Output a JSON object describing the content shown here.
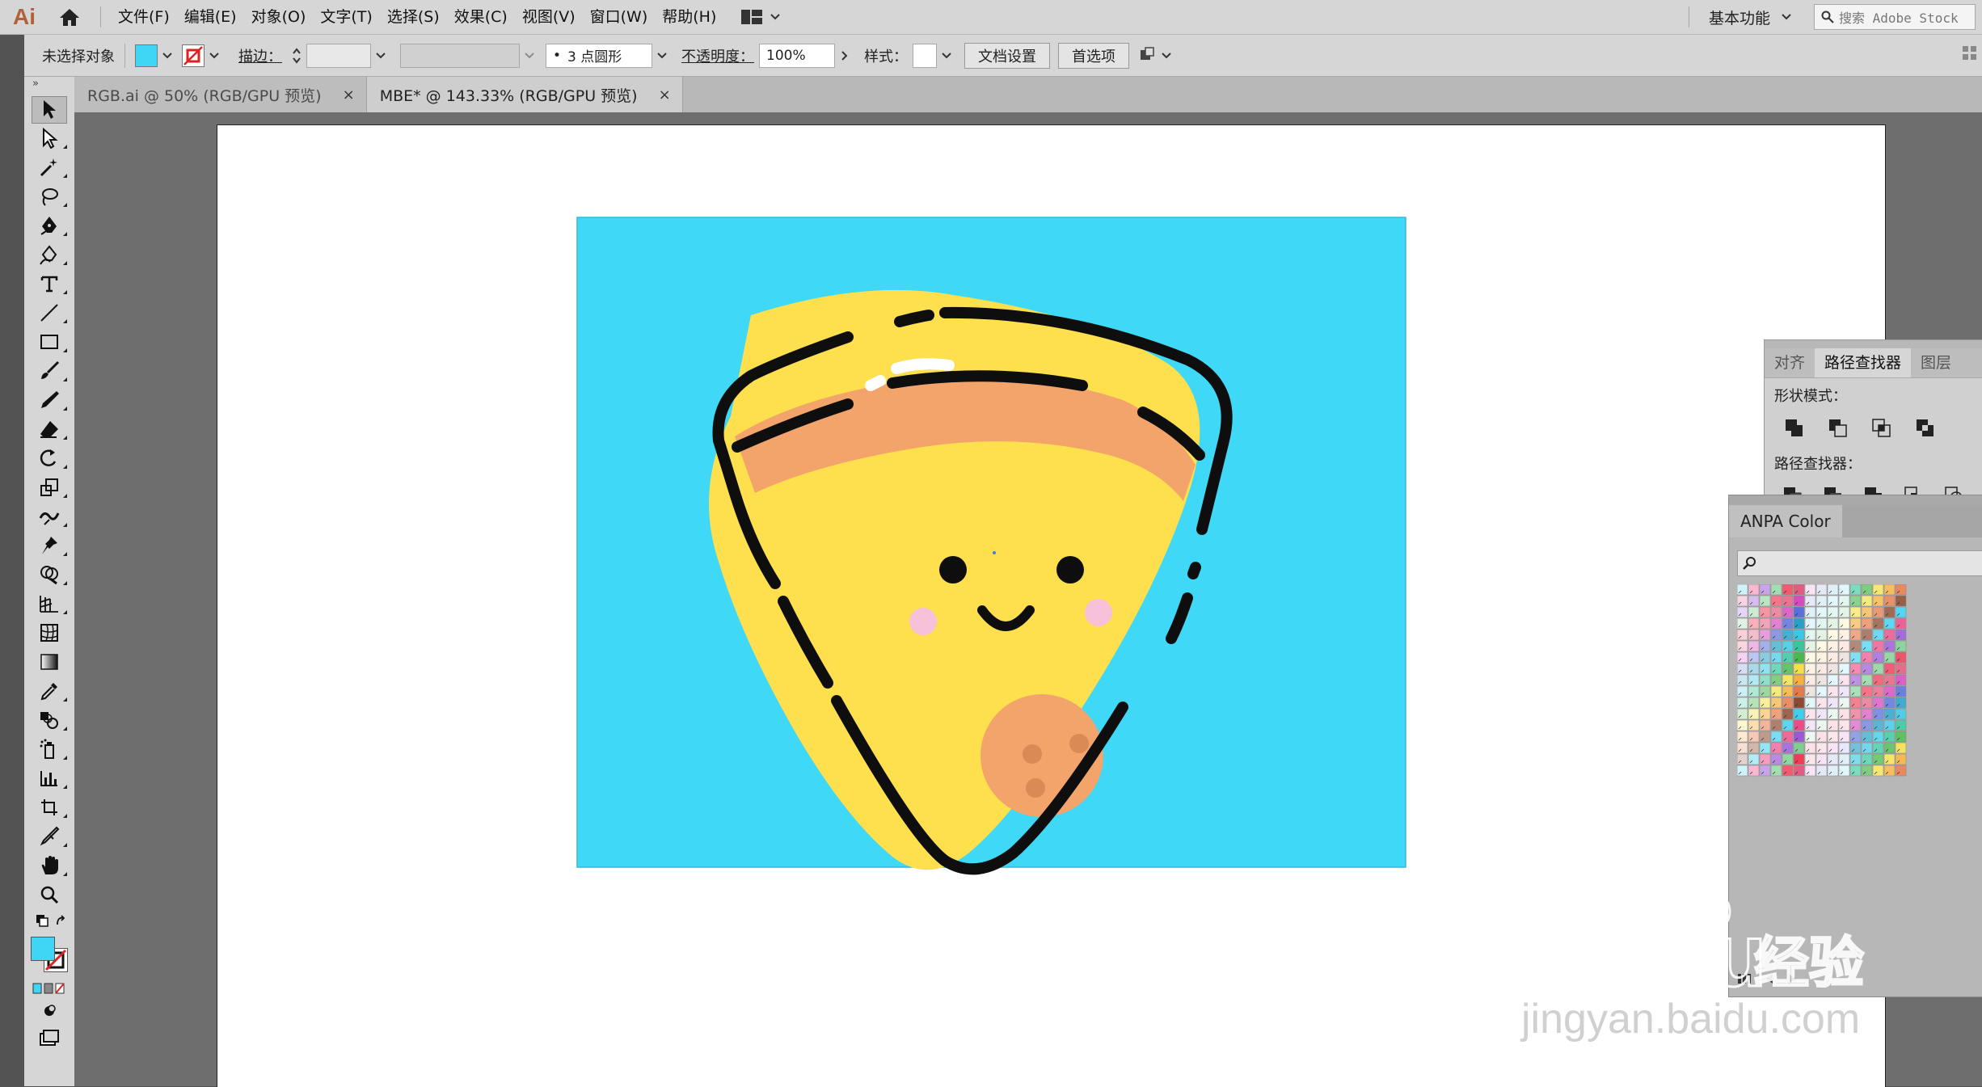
{
  "app": {
    "logo": "Ai",
    "menu": [
      "文件(F)",
      "编辑(E)",
      "对象(O)",
      "文字(T)",
      "选择(S)",
      "效果(C)",
      "视图(V)",
      "窗口(W)",
      "帮助(H)"
    ],
    "workspace_label": "基本功能",
    "stock_search_placeholder": "搜索 Adobe Stock"
  },
  "control_bar": {
    "selection_status": "未选择对象",
    "fill_color": "#3fd6f5",
    "stroke_label": "描边：",
    "brush_label": "3 点圆形",
    "brush_dot": "•",
    "opacity_label": "不透明度：",
    "opacity_value": "100%",
    "style_label": "样式：",
    "doc_setup_button": "文档设置",
    "preferences_button": "首选项"
  },
  "tabs": [
    {
      "label": "RGB.ai @ 50% (RGB/GPU 预览)",
      "close": "×",
      "active": false
    },
    {
      "label": "MBE* @ 143.33% (RGB/GPU 预览)",
      "close": "×",
      "active": true
    }
  ],
  "toolbar": {
    "grip": "»",
    "tools": [
      "selection-tool",
      "direct-selection-tool",
      "magic-wand-tool",
      "lasso-tool",
      "pen-tool",
      "curvature-tool",
      "type-tool",
      "line-segment-tool",
      "rectangle-tool",
      "paintbrush-tool",
      "shaper-tool",
      "eraser-tool",
      "rotate-tool",
      "scale-tool",
      "warp-tool",
      "puppet-warp-tool",
      "shape-builder-tool",
      "perspective-grid-tool",
      "mesh-tool",
      "gradient-tool",
      "eyedropper-tool",
      "blend-tool",
      "symbol-sprayer-tool",
      "column-graph-tool",
      "artboard-tool",
      "slice-tool",
      "hand-tool",
      "zoom-tool"
    ]
  },
  "artwork": {
    "background_color": "#3fd8f6",
    "pizza_color": "#fedf4d",
    "crust_color": "#f2a46b",
    "cheek_color": "#f7c1d9",
    "outline_color": "#0e0e0e"
  },
  "pathfinder_panel": {
    "tabs": [
      "对齐",
      "路径查找器",
      "图层"
    ],
    "active_tab": 1,
    "shape_modes_label": "形状模式：",
    "pathfinders_label": "路径查找器："
  },
  "anpa_panel": {
    "title": "ANPA Color",
    "palette": [
      "#3fd0f0",
      "#ec4d8a",
      "#9b59d6",
      "#7fcf92",
      "#ee3d56",
      "#e35b7e",
      "#d64cc0",
      "#5a6fdb",
      "#2aa0c8",
      "#3bc8e4",
      "#36c79c",
      "#4cb94f",
      "#f3e04b",
      "#f5b03d",
      "#e8794a",
      "#8c4a2f"
    ]
  },
  "watermark": {
    "brand": "Baidu",
    "suffix": "经验",
    "url": "jingyan.baidu.com"
  }
}
